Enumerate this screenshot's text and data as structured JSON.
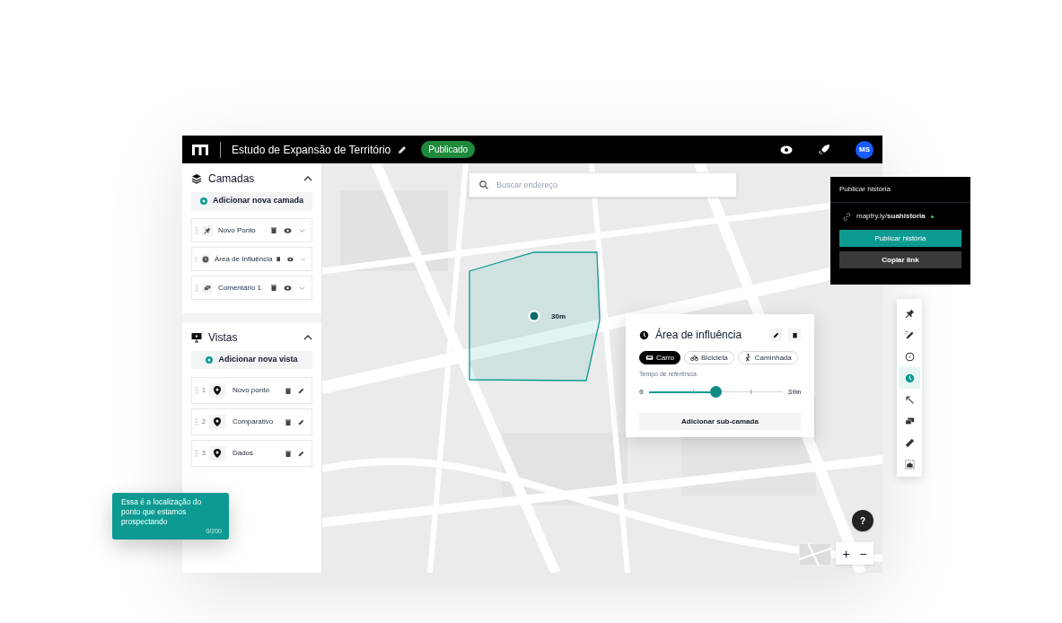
{
  "header": {
    "title": "Estudo de Expansão de Território",
    "status": "Publicado",
    "avatar": "MS"
  },
  "sidebar": {
    "sections": [
      {
        "kind": "layers",
        "title": "Camadas",
        "expanded": true,
        "add_button": "Adicionar nova camada",
        "items": [
          {
            "kind": "pin",
            "label": "Novo Ponto"
          },
          {
            "kind": "clock",
            "label": "Área de Influência"
          },
          {
            "kind": "comment",
            "label": "Comentário 1"
          }
        ]
      },
      {
        "kind": "views",
        "title": "Vistas",
        "expanded": true,
        "add_button": "Adicionar nova vista",
        "items": [
          {
            "number": "1",
            "label": "Novo ponto"
          },
          {
            "number": "2",
            "label": "Comparativo"
          },
          {
            "number": "3",
            "label": "Dados"
          }
        ]
      }
    ]
  },
  "search": {
    "placeholder": "Buscar endereço"
  },
  "map": {
    "radius_label": "30m"
  },
  "influence_panel": {
    "title": "Área de influência",
    "modes": [
      {
        "kind": "car",
        "label": "Carro",
        "selected": true
      },
      {
        "kind": "bike",
        "label": "Bicicleta",
        "selected": false
      },
      {
        "kind": "walk",
        "label": "Caminhada",
        "selected": false
      }
    ],
    "slider": {
      "label": "Tempo de referência",
      "min": "0",
      "max": "30m",
      "level": 0.5
    },
    "button": "Adicionar sub-camada"
  },
  "publish_popover": {
    "title": "Publicar história",
    "link": "mapfry.ly/**suahistoria**",
    "publish_button": "Publicar história",
    "copy_button": "Copiar link"
  },
  "tools": [
    {
      "kind": "pin",
      "selected": false
    },
    {
      "kind": "draw",
      "selected": false
    },
    {
      "kind": "circle",
      "selected": false
    },
    {
      "kind": "clock",
      "selected": true
    },
    {
      "kind": "arrow",
      "selected": false
    },
    {
      "kind": "comment",
      "selected": false
    },
    {
      "kind": "ruler",
      "selected": false
    },
    {
      "kind": "camera",
      "selected": false
    }
  ],
  "note": {
    "text": "Essa é a localização do ponto que estamos prospectando",
    "counter": "0/200"
  },
  "map_controls": {
    "help": "?",
    "zoom_in": "+",
    "zoom_out": "−"
  }
}
